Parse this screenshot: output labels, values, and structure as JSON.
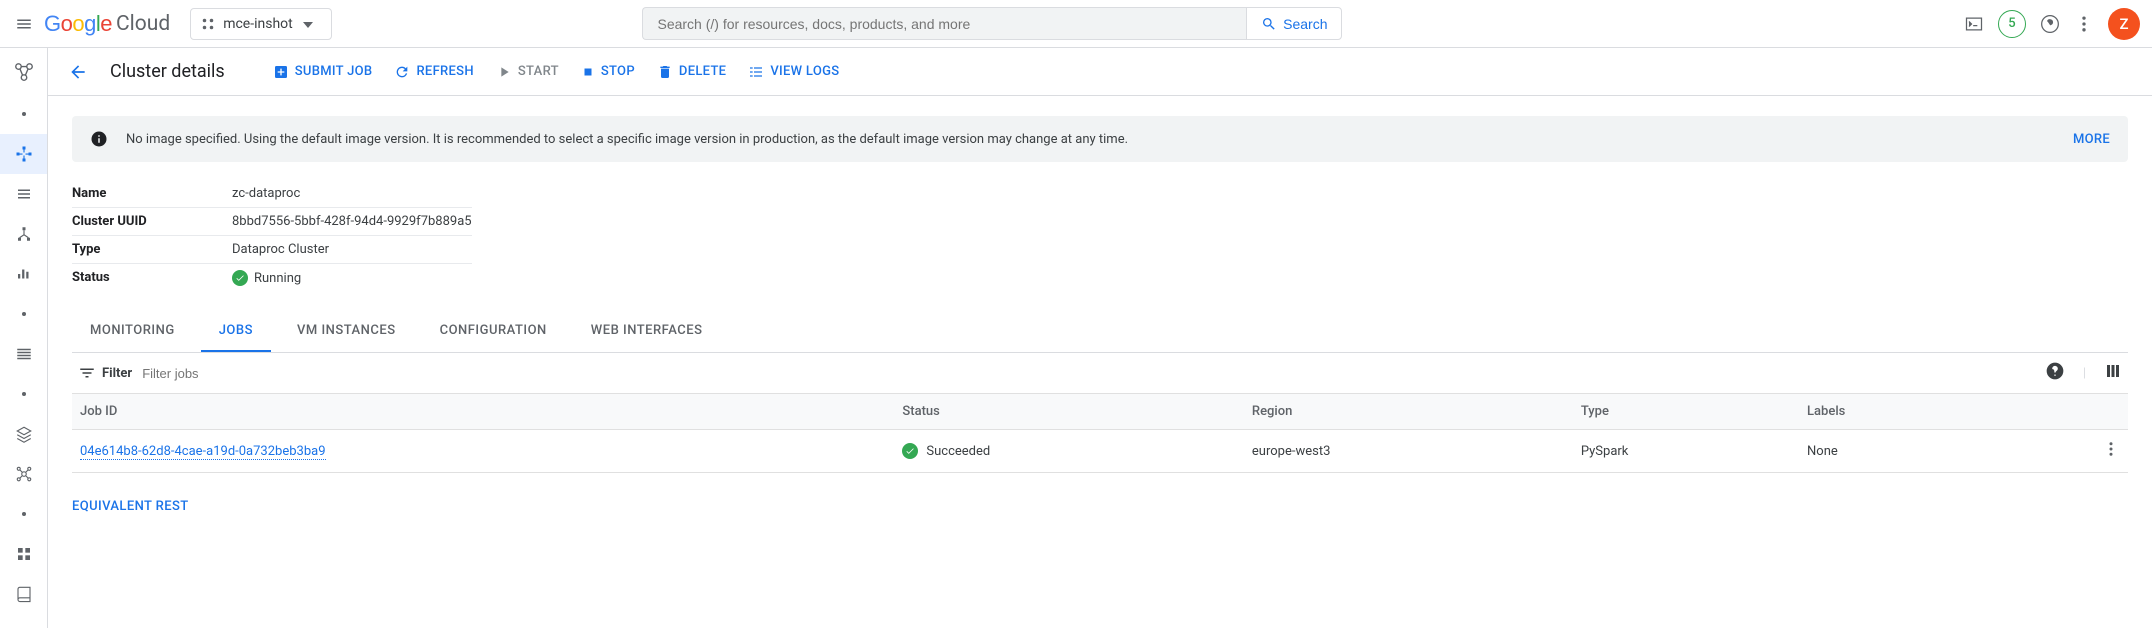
{
  "header": {
    "logo_cloud": "Cloud",
    "project_name": "mce-inshot",
    "search_placeholder": "Search (/) for resources, docs, products, and more",
    "search_button": "Search",
    "trial_badge": "5",
    "avatar_initial": "Z"
  },
  "page": {
    "title": "Cluster details",
    "actions": {
      "submit": "SUBMIT JOB",
      "refresh": "REFRESH",
      "start": "START",
      "stop": "STOP",
      "delete": "DELETE",
      "view_logs": "VIEW LOGS"
    }
  },
  "banner": {
    "text": "No image specified. Using the default image version. It is recommended to select a specific image version in production, as the default image version may change at any time.",
    "more": "MORE"
  },
  "details": {
    "name_label": "Name",
    "name_value": "zc-dataproc",
    "uuid_label": "Cluster UUID",
    "uuid_value": "8bbd7556-5bbf-428f-94d4-9929f7b889a5",
    "type_label": "Type",
    "type_value": "Dataproc Cluster",
    "status_label": "Status",
    "status_value": "Running"
  },
  "tabs": {
    "monitoring": "MONITORING",
    "jobs": "JOBS",
    "vm": "VM INSTANCES",
    "config": "CONFIGURATION",
    "web": "WEB INTERFACES"
  },
  "filter": {
    "label": "Filter",
    "placeholder": "Filter jobs"
  },
  "table": {
    "headers": {
      "job_id": "Job ID",
      "status": "Status",
      "region": "Region",
      "type": "Type",
      "labels": "Labels"
    },
    "rows": [
      {
        "job_id": "04e614b8-62d8-4cae-a19d-0a732beb3ba9",
        "status": "Succeeded",
        "region": "europe-west3",
        "type": "PySpark",
        "labels": "None"
      }
    ]
  },
  "footer": {
    "equivalent_rest": "EQUIVALENT REST"
  }
}
